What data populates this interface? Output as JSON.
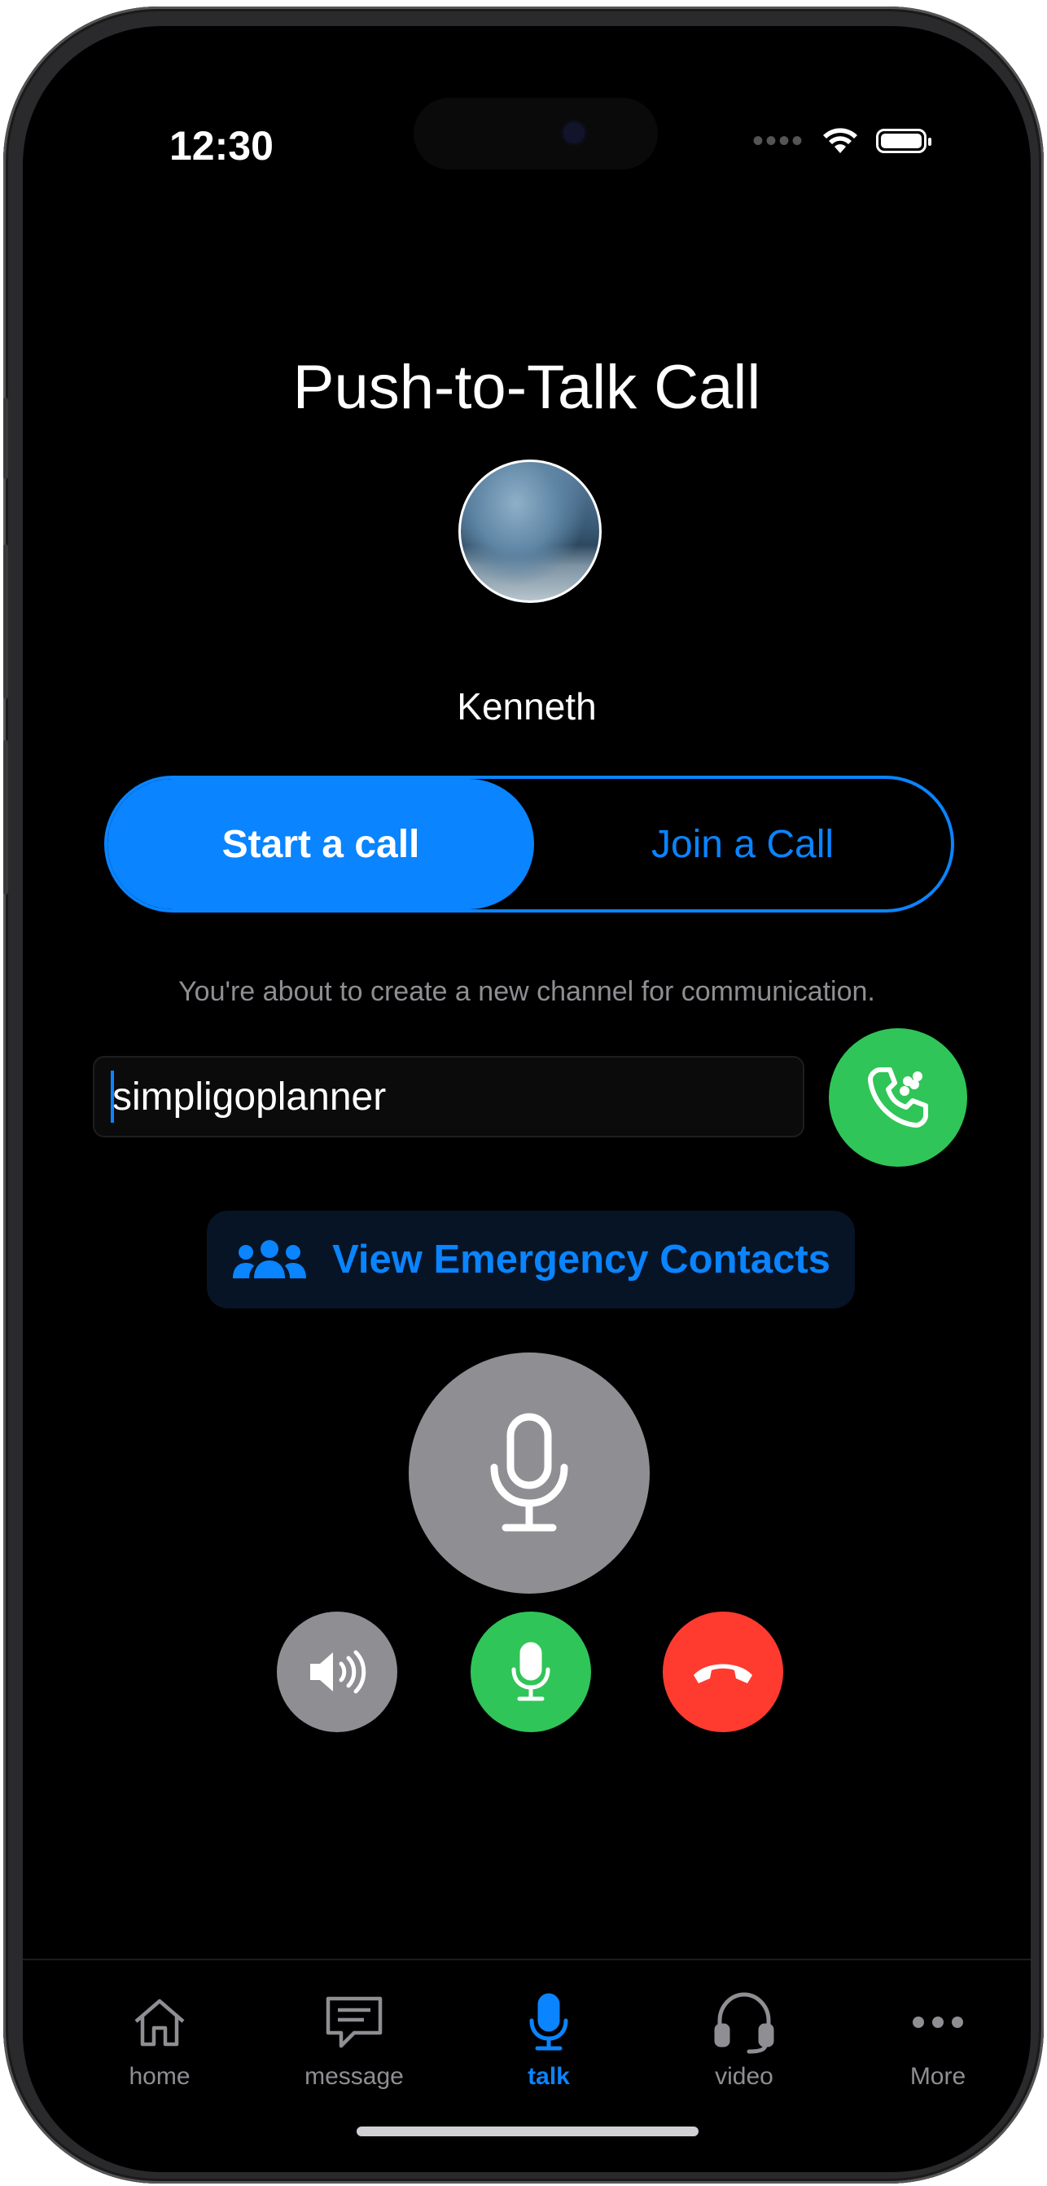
{
  "status_bar": {
    "time": "12:30",
    "icons": [
      "signal-dots-icon",
      "wifi-icon",
      "battery-icon"
    ]
  },
  "header": {
    "title": "Push-to-Talk Call"
  },
  "contact": {
    "name": "Kenneth",
    "avatar": "avatar-image"
  },
  "segmented": {
    "active_label": "Start a call",
    "inactive_label": "Join a Call"
  },
  "hint": "You're about to create a new channel for communication.",
  "channel_input": {
    "value": "simpligoplanner"
  },
  "emergency_button": {
    "label": "View Emergency Contacts",
    "icon": "people-icon"
  },
  "controls": {
    "push_to_talk": "mic-icon",
    "speaker": "speaker-icon",
    "mute": "mic-icon",
    "end": "hang-up-icon"
  },
  "tabbar": {
    "items": [
      {
        "label": "home",
        "icon": "house-icon"
      },
      {
        "label": "message",
        "icon": "message-icon"
      },
      {
        "label": "talk",
        "icon": "mic-icon",
        "active": true
      },
      {
        "label": "video",
        "icon": "headphones-icon"
      },
      {
        "label": "More",
        "icon": "ellipsis-icon"
      }
    ]
  },
  "colors": {
    "accent": "#0a84ff",
    "green": "#30c558",
    "red": "#ff3b30",
    "gray": "#8e8e93",
    "background": "#000000"
  }
}
